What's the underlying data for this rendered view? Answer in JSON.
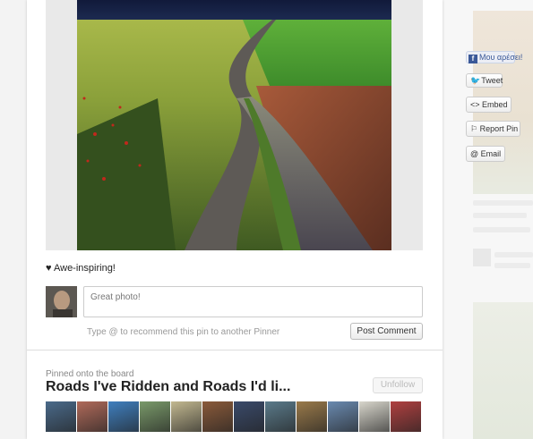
{
  "pin": {
    "description": "♥ Awe-inspiring!"
  },
  "comment": {
    "placeholder": "Great photo!",
    "hint": "Type @ to recommend this pin to another Pinner",
    "post_label": "Post Comment"
  },
  "board": {
    "label": "Pinned onto the board",
    "title": "Roads I've Ridden and Roads I'd li...",
    "unfollow_label": "Unfollow",
    "thumb_colors": [
      "#4a6a8a",
      "#b06a5a",
      "#3f7fbf",
      "#7a9a6a",
      "#c2b890",
      "#8a5a3a",
      "#3a4a6a",
      "#5a7a8a",
      "#9a7a4a",
      "#6a8ab0",
      "#d8d6cc",
      "#b04040"
    ]
  },
  "social": {
    "like_label": "Μου αρέσει!",
    "tweet_label": "Tweet",
    "embed_label": "<> Embed",
    "report_label": "⚐ Report Pin",
    "email_label": "@ Email"
  }
}
